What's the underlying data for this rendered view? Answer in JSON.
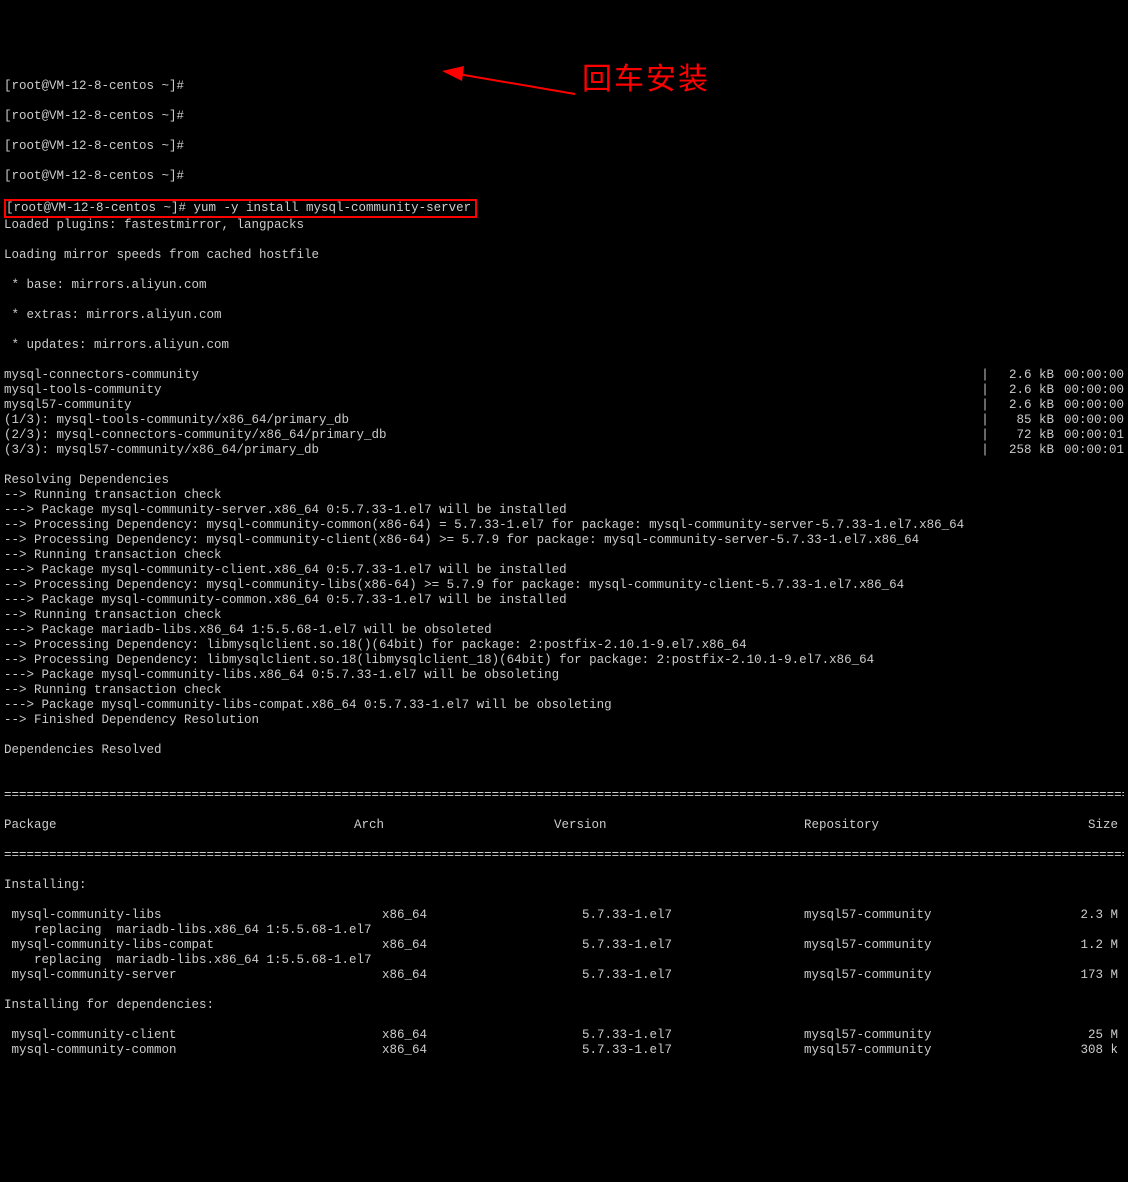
{
  "prompts": {
    "empty": "[root@VM-12-8-centos ~]#",
    "command_prompt": "[root@VM-12-8-centos ~]# ",
    "command": "yum -y install mysql-community-server"
  },
  "loading": {
    "l1": "Loaded plugins: fastestmirror, langpacks",
    "l2": "Loading mirror speeds from cached hostfile",
    "l3": " * base: mirrors.aliyun.com",
    "l4": " * extras: mirrors.aliyun.com",
    "l5": " * updates: mirrors.aliyun.com"
  },
  "downloads": [
    {
      "name": "mysql-connectors-community",
      "size": "2.6 kB",
      "time": "00:00:00"
    },
    {
      "name": "mysql-tools-community",
      "size": "2.6 kB",
      "time": "00:00:00"
    },
    {
      "name": "mysql57-community",
      "size": "2.6 kB",
      "time": "00:00:00"
    },
    {
      "name": "(1/3): mysql-tools-community/x86_64/primary_db",
      "size": "85 kB",
      "time": "00:00:00"
    },
    {
      "name": "(2/3): mysql-connectors-community/x86_64/primary_db",
      "size": "72 kB",
      "time": "00:00:01"
    },
    {
      "name": "(3/3): mysql57-community/x86_64/primary_db",
      "size": "258 kB",
      "time": "00:00:01"
    }
  ],
  "deps": [
    "Resolving Dependencies",
    "--> Running transaction check",
    "---> Package mysql-community-server.x86_64 0:5.7.33-1.el7 will be installed",
    "--> Processing Dependency: mysql-community-common(x86-64) = 5.7.33-1.el7 for package: mysql-community-server-5.7.33-1.el7.x86_64",
    "--> Processing Dependency: mysql-community-client(x86-64) >= 5.7.9 for package: mysql-community-server-5.7.33-1.el7.x86_64",
    "--> Running transaction check",
    "---> Package mysql-community-client.x86_64 0:5.7.33-1.el7 will be installed",
    "--> Processing Dependency: mysql-community-libs(x86-64) >= 5.7.9 for package: mysql-community-client-5.7.33-1.el7.x86_64",
    "---> Package mysql-community-common.x86_64 0:5.7.33-1.el7 will be installed",
    "--> Running transaction check",
    "---> Package mariadb-libs.x86_64 1:5.5.68-1.el7 will be obsoleted",
    "--> Processing Dependency: libmysqlclient.so.18()(64bit) for package: 2:postfix-2.10.1-9.el7.x86_64",
    "--> Processing Dependency: libmysqlclient.so.18(libmysqlclient_18)(64bit) for package: 2:postfix-2.10.1-9.el7.x86_64",
    "---> Package mysql-community-libs.x86_64 0:5.7.33-1.el7 will be obsoleting",
    "--> Running transaction check",
    "---> Package mysql-community-libs-compat.x86_64 0:5.7.33-1.el7 will be obsoleting",
    "--> Finished Dependency Resolution",
    "",
    "Dependencies Resolved",
    ""
  ],
  "tableHeader": {
    "pkg": "Package",
    "arch": "Arch",
    "ver": "Version",
    "repo": "Repository",
    "size": "Size"
  },
  "sections": {
    "installing": "Installing:",
    "installing_deps": "Installing for dependencies:"
  },
  "replacing": "    replacing  mariadb-libs.x86_64 1:5.5.68-1.el7",
  "pkgs_install": [
    {
      "name": " mysql-community-libs",
      "arch": "x86_64",
      "ver": "5.7.33-1.el7",
      "repo": "mysql57-community",
      "size": "2.3 M",
      "replacing": true
    },
    {
      "name": " mysql-community-libs-compat",
      "arch": "x86_64",
      "ver": "5.7.33-1.el7",
      "repo": "mysql57-community",
      "size": "1.2 M",
      "replacing": true
    },
    {
      "name": " mysql-community-server",
      "arch": "x86_64",
      "ver": "5.7.33-1.el7",
      "repo": "mysql57-community",
      "size": "173 M",
      "replacing": false
    }
  ],
  "pkgs_deps": [
    {
      "name": " mysql-community-client",
      "arch": "x86_64",
      "ver": "5.7.33-1.el7",
      "repo": "mysql57-community",
      "size": "25 M"
    },
    {
      "name": " mysql-community-common",
      "arch": "x86_64",
      "ver": "5.7.33-1.el7",
      "repo": "mysql57-community",
      "size": "308 k"
    }
  ],
  "annotation": "回车安装",
  "rule": "================================================================================================================================================================"
}
